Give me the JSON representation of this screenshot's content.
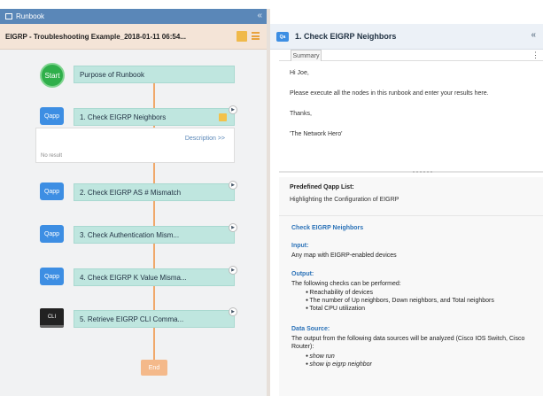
{
  "left": {
    "tab_label": "Runbook",
    "title": "EIGRP - Troubleshooting Example_2018-01-11 06:54...",
    "nodes": [
      {
        "icon": "Start",
        "label": "Purpose of Runbook"
      },
      {
        "icon": "Qapp",
        "label": "1. Check EIGRP Neighbors"
      },
      {
        "icon": "Qapp",
        "label": "2. Check EIGRP AS # Mismatch"
      },
      {
        "icon": "Qapp",
        "label": "3. Check Authentication Mism..."
      },
      {
        "icon": "Qapp",
        "label": "4. Check EIGRP K Value Misma..."
      },
      {
        "icon": "CLI",
        "label": "5. Retrieve EIGRP CLI Comma..."
      }
    ],
    "result": {
      "description_link": "Description >>",
      "status": "No result"
    },
    "end_label": "End"
  },
  "right": {
    "title": "1. Check EIGRP Neighbors",
    "tab": "Summary",
    "message": [
      "Hi Joe,",
      "Please execute all the nodes in this runbook and enter your results here.",
      "Thanks,",
      "'The Network Hero'"
    ],
    "predefined_label": "Predefined Qapp List:",
    "predefined_value": "Highlighting the Configuration of EIGRP",
    "section_title": "Check EIGRP Neighbors",
    "input_label": "Input:",
    "input_text": "Any map with EIGRP-enabled devices",
    "output_label": "Output:",
    "output_text": "The following checks can be performed:",
    "output_items": [
      "Reachability of devices",
      "The number of Up neighbors, Down neighbors, and Total neighbors",
      "Total CPU utilization"
    ],
    "datasource_label": "Data Source:",
    "datasource_text": "The output from the following data sources will be analyzed (Cisco IOS Switch, Cisco Router):",
    "datasource_items": [
      "show run",
      "show ip eigrp neighbor"
    ]
  }
}
